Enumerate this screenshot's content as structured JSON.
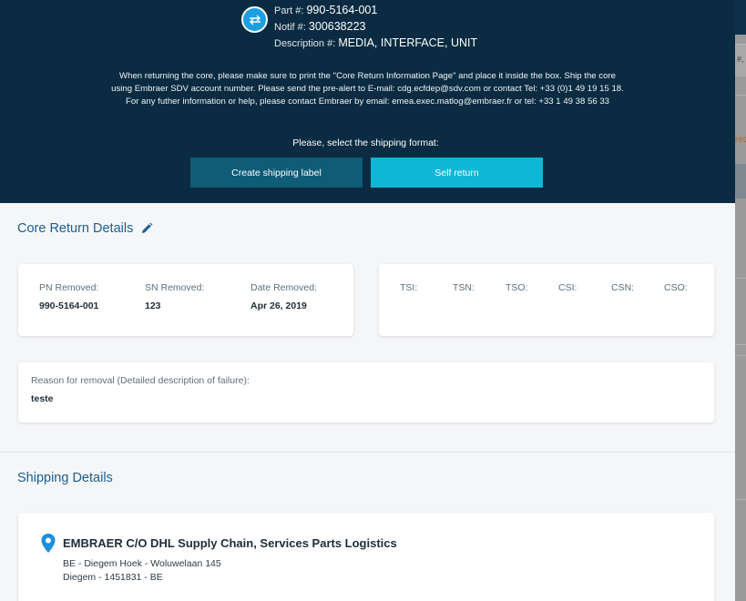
{
  "header": {
    "part_label": "Part #:",
    "part_value": "990-5164-001",
    "notif_label": "Notif #:",
    "notif_value": "300638223",
    "desc_label": "Description #:",
    "desc_value": "MEDIA, INTERFACE, UNIT",
    "notice_line1": "When returning the core, please make sure to print the \"Core Return Information Page\" and place it inside the box. Ship the core",
    "notice_line2": "using Embraer SDV account number. Please send the pre-alert to E-mail: cdg.ecfdep@sdv.com or contact Tel: +33 (0)1 49 19 15 18.",
    "notice_line3": "For any futher information or help, please contact Embraer by email: emea.exec.matlog@embraer.fr or tel: +33 1 49 38 56 33",
    "select_prompt": "Please, select the shipping format:",
    "create_label_button": "Create shipping label",
    "self_return_button": "Self return"
  },
  "core_return": {
    "title": "Core Return Details",
    "pn_removed_label": "PN Removed:",
    "pn_removed_value": "990-5164-001",
    "sn_removed_label": "SN Removed:",
    "sn_removed_value": "123",
    "date_removed_label": "Date Removed:",
    "date_removed_value": "Apr 26, 2019",
    "counters": [
      "TSI:",
      "TSN:",
      "TSO:",
      "CSI:",
      "CSN:",
      "CSO:"
    ],
    "reason_label": "Reason for removal (Detailed description of failure):",
    "reason_value": "teste"
  },
  "shipping": {
    "title": "Shipping Details",
    "company": "EMBRAER C/O DHL Supply Chain, Services Parts Logistics",
    "address_line1": "BE - Diegem Hoek - Woluwelaan 145",
    "address_line2": "Diegem - 1451831 - BE"
  },
  "background": {
    "partial_text_1": "#,",
    "partial_text_2": "rec"
  },
  "colors": {
    "hero_bg": "#0a2b41",
    "create_button": "#0e5c78",
    "self_return_button": "#0eb7d6",
    "accent_title": "#1a5e91",
    "pin": "#1b8fd8"
  },
  "icons": {
    "swap": "swap-arrows-icon",
    "edit": "pencil-icon",
    "location": "map-pin-icon"
  }
}
